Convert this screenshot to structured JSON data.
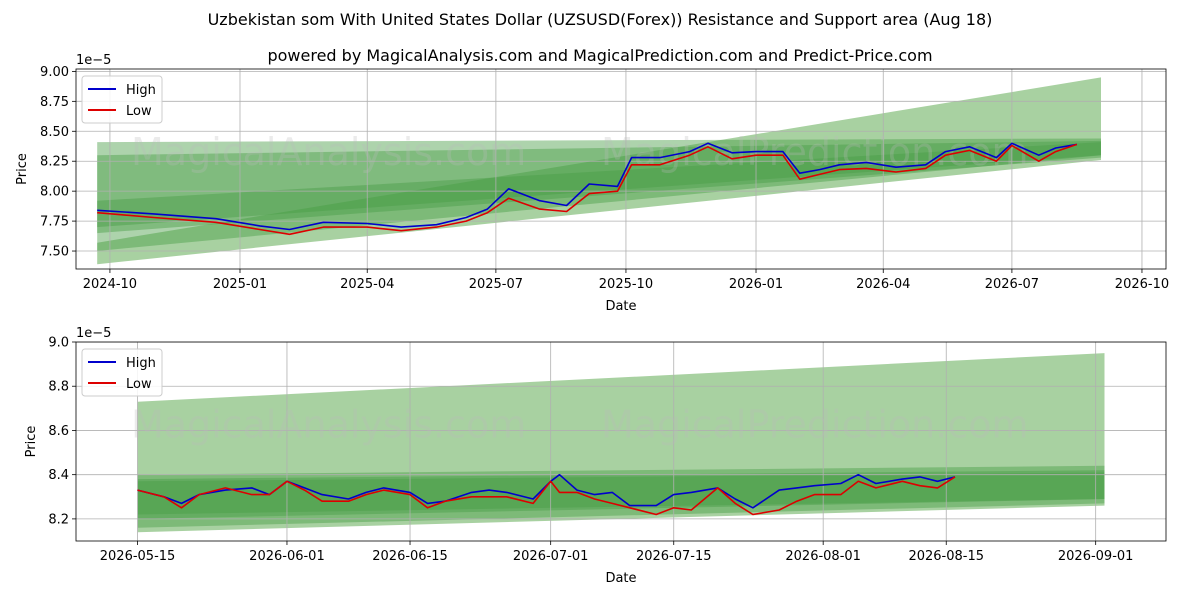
{
  "title": "Uzbekistan som With United States Dollar (UZSUSD(Forex)) Resistance and Support area (Aug 18)",
  "subtitle": "powered by MagicalAnalysis.com and MagicalPrediction.com and Predict-Price.com",
  "watermarks": [
    "MagicalAnalysis.com",
    "MagicalPrediction.com"
  ],
  "colors": {
    "high": "#0000cc",
    "low": "#dd0000",
    "band_light": "#a3cf9c",
    "band_dark": "#4a9e48"
  },
  "chart_data": [
    {
      "type": "line",
      "xlabel": "Date",
      "ylabel": "Price",
      "offset_label": "1e−5",
      "xlim": [
        "2024-09-07",
        "2026-10-18"
      ],
      "ylim": [
        7.35,
        9.02
      ],
      "xticks": [
        "2024-10-01",
        "2025-01-01",
        "2025-04-01",
        "2025-07-01",
        "2025-10-01",
        "2026-01-01",
        "2026-04-01",
        "2026-07-01",
        "2026-10-01"
      ],
      "xtick_labels": [
        "2024-10",
        "2025-01",
        "2025-04",
        "2025-07",
        "2025-10",
        "2026-01",
        "2026-04",
        "2026-07",
        "2026-10"
      ],
      "yticks": [
        7.5,
        7.75,
        8.0,
        8.25,
        8.5,
        8.75,
        9.0
      ],
      "ytick_labels": [
        "7.50",
        "7.75",
        "8.00",
        "8.25",
        "8.50",
        "8.75",
        "9.00"
      ],
      "legend": {
        "placement": "top-left",
        "entries": [
          "High",
          "Low"
        ]
      },
      "grid": true,
      "series": [
        {
          "name": "High",
          "x": [
            "2024-09-22",
            "2024-11-01",
            "2024-12-15",
            "2025-01-15",
            "2025-02-05",
            "2025-03-01",
            "2025-04-01",
            "2025-04-25",
            "2025-05-20",
            "2025-06-10",
            "2025-06-25",
            "2025-07-10",
            "2025-08-01",
            "2025-08-20",
            "2025-09-05",
            "2025-09-25",
            "2025-10-05",
            "2025-10-25",
            "2025-11-15",
            "2025-11-28",
            "2025-12-15",
            "2026-01-01",
            "2026-01-20",
            "2026-02-01",
            "2026-02-15",
            "2026-03-01",
            "2026-03-20",
            "2026-04-10",
            "2026-05-01",
            "2026-05-15",
            "2026-06-01",
            "2026-06-20",
            "2026-07-01",
            "2026-07-20",
            "2026-08-01",
            "2026-08-16"
          ],
          "values": [
            7.84,
            7.81,
            7.77,
            7.71,
            7.68,
            7.74,
            7.73,
            7.7,
            7.72,
            7.78,
            7.85,
            8.02,
            7.92,
            7.88,
            8.06,
            8.04,
            8.28,
            8.28,
            8.33,
            8.4,
            8.32,
            8.33,
            8.33,
            8.15,
            8.18,
            8.22,
            8.24,
            8.2,
            8.22,
            8.33,
            8.37,
            8.28,
            8.4,
            8.3,
            8.36,
            8.39
          ]
        },
        {
          "name": "Low",
          "x": [
            "2024-09-22",
            "2024-11-01",
            "2024-12-15",
            "2025-01-15",
            "2025-02-05",
            "2025-03-01",
            "2025-04-01",
            "2025-04-25",
            "2025-05-20",
            "2025-06-10",
            "2025-06-25",
            "2025-07-10",
            "2025-08-01",
            "2025-08-20",
            "2025-09-05",
            "2025-09-25",
            "2025-10-05",
            "2025-10-25",
            "2025-11-15",
            "2025-11-28",
            "2025-12-15",
            "2026-01-01",
            "2026-01-20",
            "2026-02-01",
            "2026-02-15",
            "2026-03-01",
            "2026-03-20",
            "2026-04-10",
            "2026-05-01",
            "2026-05-15",
            "2026-06-01",
            "2026-06-20",
            "2026-07-01",
            "2026-07-20",
            "2026-08-01",
            "2026-08-16"
          ],
          "values": [
            7.82,
            7.78,
            7.74,
            7.68,
            7.64,
            7.7,
            7.7,
            7.67,
            7.7,
            7.75,
            7.82,
            7.94,
            7.85,
            7.83,
            7.98,
            8.0,
            8.22,
            8.22,
            8.3,
            8.37,
            8.27,
            8.3,
            8.3,
            8.1,
            8.14,
            8.18,
            8.19,
            8.16,
            8.19,
            8.3,
            8.34,
            8.25,
            8.38,
            8.25,
            8.33,
            8.39
          ]
        }
      ],
      "bands": [
        {
          "x": [
            "2024-09-22",
            "2026-09-02"
          ],
          "upper": [
            7.57,
            8.95
          ],
          "lower": [
            7.39,
            8.26
          ]
        },
        {
          "x": [
            "2024-09-22",
            "2026-09-02"
          ],
          "upper": [
            8.41,
            8.44
          ],
          "lower": [
            7.65,
            8.28
          ]
        },
        {
          "x": [
            "2024-09-22",
            "2026-09-02"
          ],
          "upper": [
            8.3,
            8.42
          ],
          "lower": [
            7.5,
            8.3
          ]
        },
        {
          "x": [
            "2024-09-22",
            "2026-09-02"
          ],
          "upper": [
            7.92,
            8.41
          ],
          "lower": [
            7.7,
            8.3
          ]
        }
      ]
    },
    {
      "type": "line",
      "xlabel": "Date",
      "ylabel": "Price",
      "offset_label": "1e−5",
      "xlim": [
        "2026-05-08",
        "2026-09-09"
      ],
      "ylim": [
        8.1,
        9.0
      ],
      "xticks": [
        "2026-05-15",
        "2026-06-01",
        "2026-06-15",
        "2026-07-01",
        "2026-07-15",
        "2026-08-01",
        "2026-08-15",
        "2026-09-01"
      ],
      "xtick_labels": [
        "2026-05-15",
        "2026-06-01",
        "2026-06-15",
        "2026-07-01",
        "2026-07-15",
        "2026-08-01",
        "2026-08-15",
        "2026-09-01"
      ],
      "yticks": [
        8.2,
        8.4,
        8.6,
        8.8,
        9.0
      ],
      "ytick_labels": [
        "8.2",
        "8.4",
        "8.6",
        "8.8",
        "9.0"
      ],
      "legend": {
        "placement": "top-left",
        "entries": [
          "High",
          "Low"
        ]
      },
      "grid": true,
      "series": [
        {
          "name": "High",
          "x": [
            "2026-05-15",
            "2026-05-18",
            "2026-05-20",
            "2026-05-22",
            "2026-05-25",
            "2026-05-28",
            "2026-05-30",
            "2026-06-01",
            "2026-06-03",
            "2026-06-05",
            "2026-06-08",
            "2026-06-10",
            "2026-06-12",
            "2026-06-15",
            "2026-06-17",
            "2026-06-19",
            "2026-06-22",
            "2026-06-24",
            "2026-06-26",
            "2026-06-29",
            "2026-07-01",
            "2026-07-02",
            "2026-07-04",
            "2026-07-06",
            "2026-07-08",
            "2026-07-10",
            "2026-07-13",
            "2026-07-15",
            "2026-07-17",
            "2026-07-20",
            "2026-07-22",
            "2026-07-24",
            "2026-07-27",
            "2026-07-29",
            "2026-07-31",
            "2026-08-03",
            "2026-08-05",
            "2026-08-07",
            "2026-08-10",
            "2026-08-12",
            "2026-08-14",
            "2026-08-16"
          ],
          "values": [
            8.33,
            8.3,
            8.27,
            8.31,
            8.33,
            8.34,
            8.31,
            8.37,
            8.34,
            8.31,
            8.29,
            8.32,
            8.34,
            8.32,
            8.27,
            8.28,
            8.32,
            8.33,
            8.32,
            8.29,
            8.37,
            8.4,
            8.33,
            8.31,
            8.32,
            8.26,
            8.26,
            8.31,
            8.32,
            8.34,
            8.29,
            8.25,
            8.33,
            8.34,
            8.35,
            8.36,
            8.4,
            8.36,
            8.38,
            8.39,
            8.37,
            8.39
          ]
        },
        {
          "name": "Low",
          "x": [
            "2026-05-15",
            "2026-05-18",
            "2026-05-20",
            "2026-05-22",
            "2026-05-25",
            "2026-05-28",
            "2026-05-30",
            "2026-06-01",
            "2026-06-03",
            "2026-06-05",
            "2026-06-08",
            "2026-06-10",
            "2026-06-12",
            "2026-06-15",
            "2026-06-17",
            "2026-06-19",
            "2026-06-22",
            "2026-06-24",
            "2026-06-26",
            "2026-06-29",
            "2026-07-01",
            "2026-07-02",
            "2026-07-04",
            "2026-07-06",
            "2026-07-08",
            "2026-07-10",
            "2026-07-13",
            "2026-07-15",
            "2026-07-17",
            "2026-07-20",
            "2026-07-22",
            "2026-07-24",
            "2026-07-27",
            "2026-07-29",
            "2026-07-31",
            "2026-08-03",
            "2026-08-05",
            "2026-08-07",
            "2026-08-10",
            "2026-08-12",
            "2026-08-14",
            "2026-08-16"
          ],
          "values": [
            8.33,
            8.3,
            8.25,
            8.31,
            8.34,
            8.31,
            8.31,
            8.37,
            8.33,
            8.28,
            8.28,
            8.31,
            8.33,
            8.31,
            8.25,
            8.28,
            8.3,
            8.3,
            8.3,
            8.27,
            8.37,
            8.32,
            8.32,
            8.29,
            8.27,
            8.25,
            8.22,
            8.25,
            8.24,
            8.34,
            8.27,
            8.22,
            8.24,
            8.28,
            8.31,
            8.31,
            8.37,
            8.34,
            8.37,
            8.35,
            8.34,
            8.39
          ]
        }
      ],
      "bands": [
        {
          "x": [
            "2026-05-15",
            "2026-09-02"
          ],
          "upper": [
            8.73,
            8.95
          ],
          "lower": [
            8.14,
            8.26
          ]
        },
        {
          "x": [
            "2026-05-15",
            "2026-09-02"
          ],
          "upper": [
            8.4,
            8.44
          ],
          "lower": [
            8.16,
            8.27
          ]
        },
        {
          "x": [
            "2026-05-15",
            "2026-09-02"
          ],
          "upper": [
            8.38,
            8.42
          ],
          "lower": [
            8.2,
            8.29
          ]
        },
        {
          "x": [
            "2026-05-15",
            "2026-09-02"
          ],
          "upper": [
            8.37,
            8.41
          ],
          "lower": [
            8.22,
            8.29
          ]
        }
      ]
    }
  ]
}
